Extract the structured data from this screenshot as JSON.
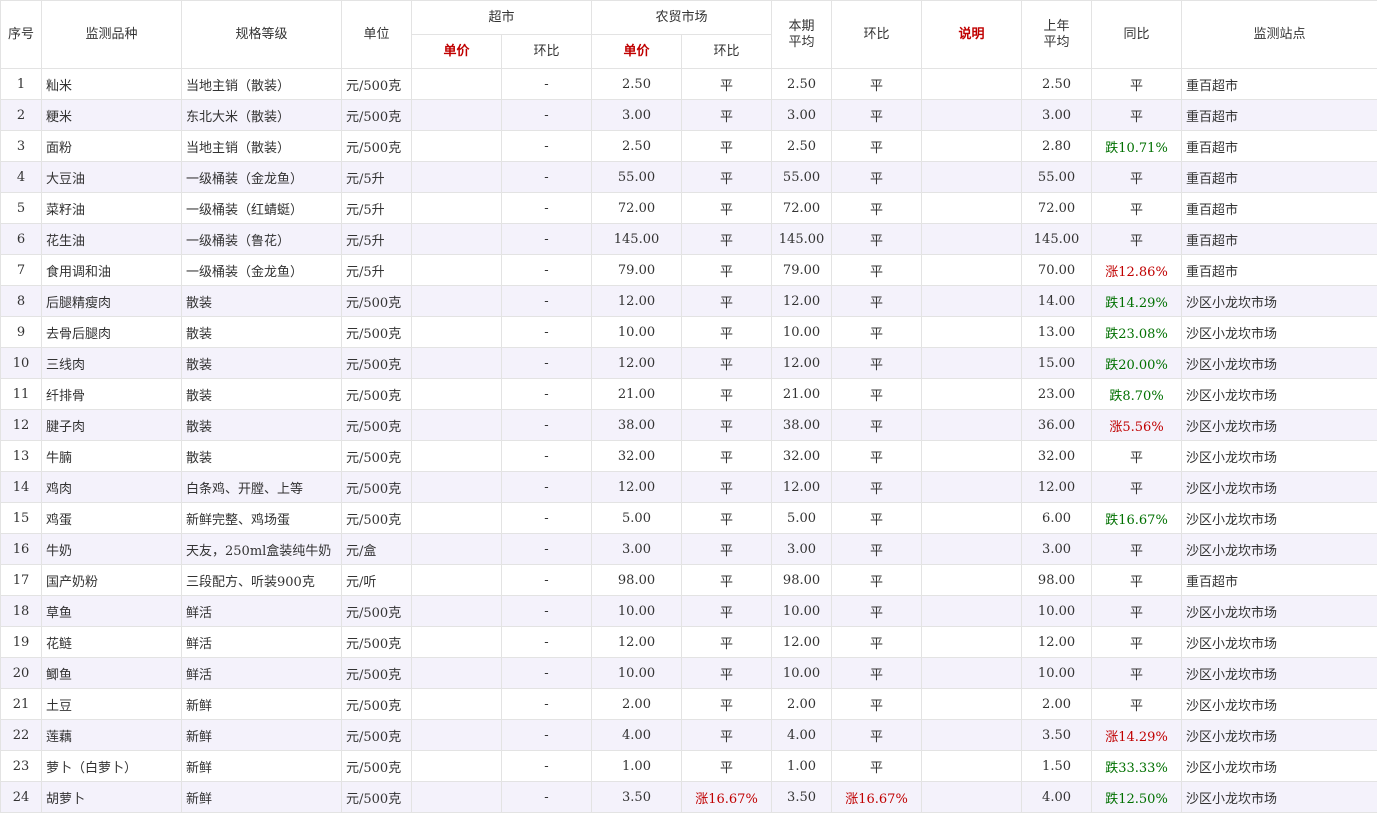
{
  "headers": {
    "index": "序号",
    "item": "监测品种",
    "spec": "规格等级",
    "unit": "单位",
    "supermarket": "超市",
    "market": "农贸市场",
    "unit_price": "单价",
    "mom": "环比",
    "period_avg": "本期平均",
    "note": "说明",
    "last_year_avg": "上年平均",
    "yoy": "同比",
    "station": "监测站点"
  },
  "rows": [
    {
      "no": "1",
      "item": "籼米",
      "spec": "当地主销（散装）",
      "unit": "元/500克",
      "sm_mom": "-",
      "mk_price": "2.50",
      "mk_mom": "平",
      "avg": "2.50",
      "mom": "平",
      "note": "",
      "last": "2.50",
      "yoy": "平",
      "station": "重百超市"
    },
    {
      "no": "2",
      "item": "粳米",
      "spec": "东北大米（散装）",
      "unit": "元/500克",
      "sm_mom": "-",
      "mk_price": "3.00",
      "mk_mom": "平",
      "avg": "3.00",
      "mom": "平",
      "note": "",
      "last": "3.00",
      "yoy": "平",
      "station": "重百超市"
    },
    {
      "no": "3",
      "item": "面粉",
      "spec": "当地主销（散装）",
      "unit": "元/500克",
      "sm_mom": "-",
      "mk_price": "2.50",
      "mk_mom": "平",
      "avg": "2.50",
      "mom": "平",
      "note": "",
      "last": "2.80",
      "yoy": "跌10.71%",
      "station": "重百超市"
    },
    {
      "no": "4",
      "item": "大豆油",
      "spec": "一级桶装（金龙鱼）",
      "unit": "元/5升",
      "sm_mom": "-",
      "mk_price": "55.00",
      "mk_mom": "平",
      "avg": "55.00",
      "mom": "平",
      "note": "",
      "last": "55.00",
      "yoy": "平",
      "station": "重百超市"
    },
    {
      "no": "5",
      "item": "菜籽油",
      "spec": "一级桶装（红蜻蜓）",
      "unit": "元/5升",
      "sm_mom": "-",
      "mk_price": "72.00",
      "mk_mom": "平",
      "avg": "72.00",
      "mom": "平",
      "note": "",
      "last": "72.00",
      "yoy": "平",
      "station": "重百超市"
    },
    {
      "no": "6",
      "item": "花生油",
      "spec": "一级桶装（鲁花）",
      "unit": "元/5升",
      "sm_mom": "-",
      "mk_price": "145.00",
      "mk_mom": "平",
      "avg": "145.00",
      "mom": "平",
      "note": "",
      "last": "145.00",
      "yoy": "平",
      "station": "重百超市"
    },
    {
      "no": "7",
      "item": "食用调和油",
      "spec": "一级桶装（金龙鱼）",
      "unit": "元/5升",
      "sm_mom": "-",
      "mk_price": "79.00",
      "mk_mom": "平",
      "avg": "79.00",
      "mom": "平",
      "note": "",
      "last": "70.00",
      "yoy": "涨12.86%",
      "station": "重百超市"
    },
    {
      "no": "8",
      "item": "后腿精瘦肉",
      "spec": "散装",
      "unit": "元/500克",
      "sm_mom": "-",
      "mk_price": "12.00",
      "mk_mom": "平",
      "avg": "12.00",
      "mom": "平",
      "note": "",
      "last": "14.00",
      "yoy": "跌14.29%",
      "station": "沙区小龙坎市场"
    },
    {
      "no": "9",
      "item": "去骨后腿肉",
      "spec": "散装",
      "unit": "元/500克",
      "sm_mom": "-",
      "mk_price": "10.00",
      "mk_mom": "平",
      "avg": "10.00",
      "mom": "平",
      "note": "",
      "last": "13.00",
      "yoy": "跌23.08%",
      "station": "沙区小龙坎市场"
    },
    {
      "no": "10",
      "item": "三线肉",
      "spec": "散装",
      "unit": "元/500克",
      "sm_mom": "-",
      "mk_price": "12.00",
      "mk_mom": "平",
      "avg": "12.00",
      "mom": "平",
      "note": "",
      "last": "15.00",
      "yoy": "跌20.00%",
      "station": "沙区小龙坎市场"
    },
    {
      "no": "11",
      "item": "纤排骨",
      "spec": "散装",
      "unit": "元/500克",
      "sm_mom": "-",
      "mk_price": "21.00",
      "mk_mom": "平",
      "avg": "21.00",
      "mom": "平",
      "note": "",
      "last": "23.00",
      "yoy": "跌8.70%",
      "station": "沙区小龙坎市场"
    },
    {
      "no": "12",
      "item": "腱子肉",
      "spec": "散装",
      "unit": "元/500克",
      "sm_mom": "-",
      "mk_price": "38.00",
      "mk_mom": "平",
      "avg": "38.00",
      "mom": "平",
      "note": "",
      "last": "36.00",
      "yoy": "涨5.56%",
      "station": "沙区小龙坎市场"
    },
    {
      "no": "13",
      "item": "牛腩",
      "spec": "散装",
      "unit": "元/500克",
      "sm_mom": "-",
      "mk_price": "32.00",
      "mk_mom": "平",
      "avg": "32.00",
      "mom": "平",
      "note": "",
      "last": "32.00",
      "yoy": "平",
      "station": "沙区小龙坎市场"
    },
    {
      "no": "14",
      "item": "鸡肉",
      "spec": "白条鸡、开膛、上等",
      "unit": "元/500克",
      "sm_mom": "-",
      "mk_price": "12.00",
      "mk_mom": "平",
      "avg": "12.00",
      "mom": "平",
      "note": "",
      "last": "12.00",
      "yoy": "平",
      "station": "沙区小龙坎市场"
    },
    {
      "no": "15",
      "item": "鸡蛋",
      "spec": "新鲜完整、鸡场蛋",
      "unit": "元/500克",
      "sm_mom": "-",
      "mk_price": "5.00",
      "mk_mom": "平",
      "avg": "5.00",
      "mom": "平",
      "note": "",
      "last": "6.00",
      "yoy": "跌16.67%",
      "station": "沙区小龙坎市场"
    },
    {
      "no": "16",
      "item": "牛奶",
      "spec": "天友，250ml盒装纯牛奶",
      "unit": "元/盒",
      "sm_mom": "-",
      "mk_price": "3.00",
      "mk_mom": "平",
      "avg": "3.00",
      "mom": "平",
      "note": "",
      "last": "3.00",
      "yoy": "平",
      "station": "沙区小龙坎市场"
    },
    {
      "no": "17",
      "item": "国产奶粉",
      "spec": "三段配方、听装900克",
      "unit": "元/听",
      "sm_mom": "-",
      "mk_price": "98.00",
      "mk_mom": "平",
      "avg": "98.00",
      "mom": "平",
      "note": "",
      "last": "98.00",
      "yoy": "平",
      "station": "重百超市"
    },
    {
      "no": "18",
      "item": "草鱼",
      "spec": "鲜活",
      "unit": "元/500克",
      "sm_mom": "-",
      "mk_price": "10.00",
      "mk_mom": "平",
      "avg": "10.00",
      "mom": "平",
      "note": "",
      "last": "10.00",
      "yoy": "平",
      "station": "沙区小龙坎市场"
    },
    {
      "no": "19",
      "item": "花鲢",
      "spec": "鲜活",
      "unit": "元/500克",
      "sm_mom": "-",
      "mk_price": "12.00",
      "mk_mom": "平",
      "avg": "12.00",
      "mom": "平",
      "note": "",
      "last": "12.00",
      "yoy": "平",
      "station": "沙区小龙坎市场"
    },
    {
      "no": "20",
      "item": "鲫鱼",
      "spec": "鲜活",
      "unit": "元/500克",
      "sm_mom": "-",
      "mk_price": "10.00",
      "mk_mom": "平",
      "avg": "10.00",
      "mom": "平",
      "note": "",
      "last": "10.00",
      "yoy": "平",
      "station": "沙区小龙坎市场"
    },
    {
      "no": "21",
      "item": "土豆",
      "spec": "新鲜",
      "unit": "元/500克",
      "sm_mom": "-",
      "mk_price": "2.00",
      "mk_mom": "平",
      "avg": "2.00",
      "mom": "平",
      "note": "",
      "last": "2.00",
      "yoy": "平",
      "station": "沙区小龙坎市场"
    },
    {
      "no": "22",
      "item": "莲藕",
      "spec": "新鲜",
      "unit": "元/500克",
      "sm_mom": "-",
      "mk_price": "4.00",
      "mk_mom": "平",
      "avg": "4.00",
      "mom": "平",
      "note": "",
      "last": "3.50",
      "yoy": "涨14.29%",
      "station": "沙区小龙坎市场"
    },
    {
      "no": "23",
      "item": "萝卜（白萝卜）",
      "spec": "新鲜",
      "unit": "元/500克",
      "sm_mom": "-",
      "mk_price": "1.00",
      "mk_mom": "平",
      "avg": "1.00",
      "mom": "平",
      "note": "",
      "last": "1.50",
      "yoy": "跌33.33%",
      "station": "沙区小龙坎市场"
    },
    {
      "no": "24",
      "item": "胡萝卜",
      "spec": "新鲜",
      "unit": "元/500克",
      "sm_mom": "-",
      "mk_price": "3.50",
      "mk_mom": "涨16.67%",
      "avg": "3.50",
      "mom": "涨16.67%",
      "note": "",
      "last": "4.00",
      "yoy": "跌12.50%",
      "station": "沙区小龙坎市场"
    }
  ]
}
